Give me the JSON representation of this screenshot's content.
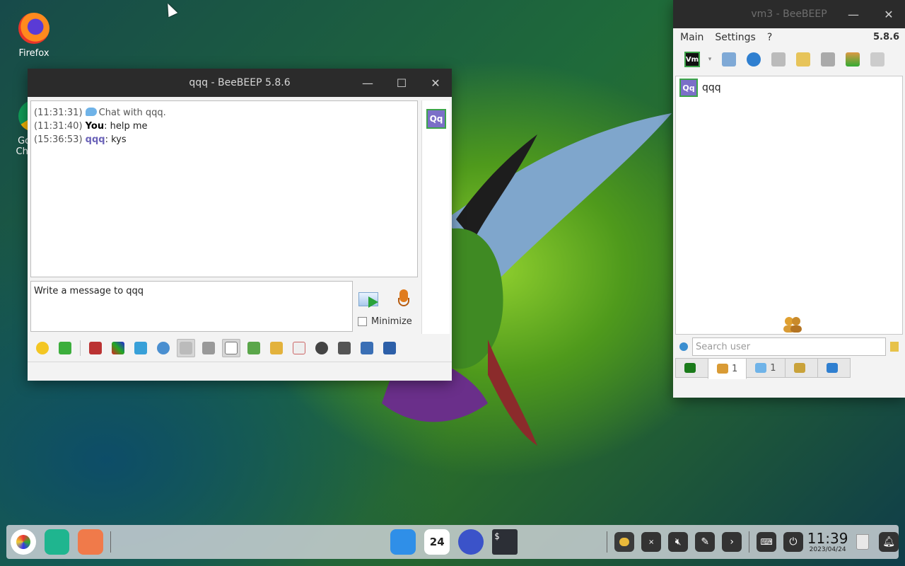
{
  "desktop": {
    "icons": [
      {
        "label": "Firefox"
      },
      {
        "label": "Google Chrome"
      }
    ]
  },
  "chat_window": {
    "title": "qqq - BeeBEEP 5.8.6",
    "controls": {
      "minimize": "—",
      "maximize": "☐",
      "close": "✕"
    },
    "messages": [
      {
        "time": "(11:31:31)",
        "sender": "",
        "text": "Chat with qqq."
      },
      {
        "time": "(11:31:40)",
        "sender": "You",
        "text": ": help me"
      },
      {
        "time": "(15:36:53)",
        "sender": "qqq",
        "text": ": kys"
      }
    ],
    "peer_avatar": "Qq",
    "input_value": "Write a message to qqq",
    "minimize_label": "Minimize"
  },
  "main_window": {
    "title": "vm3 - BeeBEEP",
    "controls": {
      "minimize": "—",
      "close": "✕"
    },
    "menu": [
      "Main",
      "Settings",
      "?"
    ],
    "version": "5.8.6",
    "user_badge": "Vm",
    "users": [
      {
        "avatar": "Qq",
        "name": "qqq"
      }
    ],
    "search_placeholder": "Search user",
    "tabs": [
      {
        "count": ""
      },
      {
        "count": "1"
      },
      {
        "count": "1"
      },
      {
        "count": ""
      },
      {
        "count": ""
      }
    ]
  },
  "taskbar": {
    "calendar_day": "24",
    "terminal_label": "$",
    "clock_time": "11:39",
    "clock_date": "2023/04/24"
  },
  "colors": {
    "peer_name": "#6a62b8",
    "avatar_bg": "#7b6fc8",
    "avatar_border": "#3da54a",
    "titlebar": "#2b2b2b"
  }
}
